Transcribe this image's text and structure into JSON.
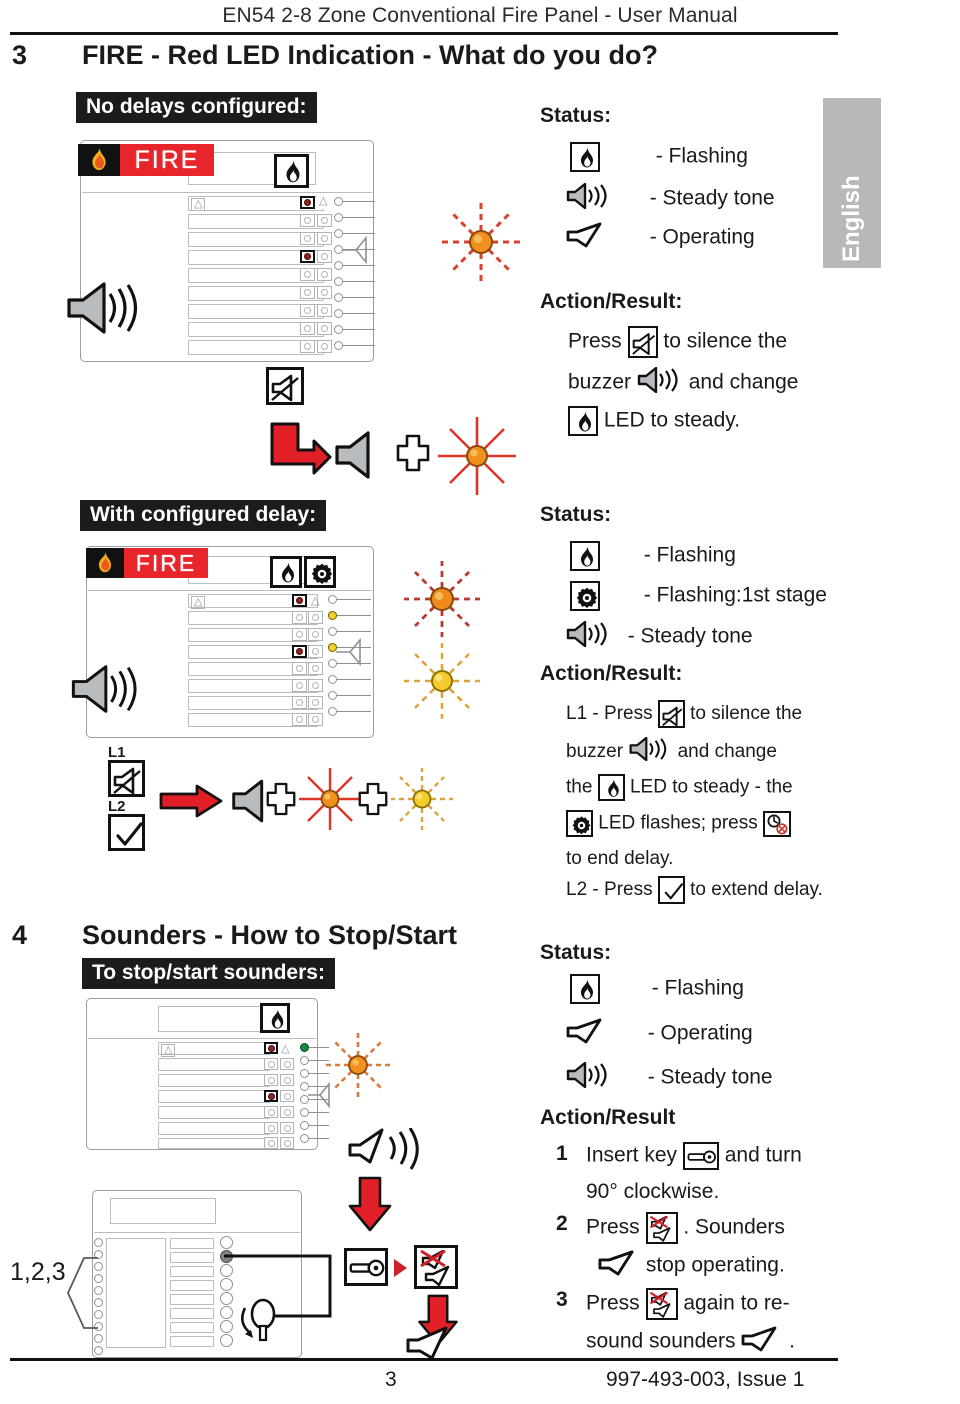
{
  "document": {
    "header_title": "EN54 2-8 Zone Conventional Fire Panel - User Manual",
    "language_tab": "English",
    "footer_page": "3",
    "footer_code": "997-493-003, Issue 1"
  },
  "colors": {
    "fire_red": "#e8252a",
    "arrow_red": "#e02026",
    "led_red": "#9e1b1b",
    "amber": "#f5a623",
    "yellow": "#f2d22a",
    "chip_black": "#1c1c1c",
    "tab_gray": "#b6b8ba",
    "panel_line": "#9b9fa3"
  },
  "section3": {
    "number": "3",
    "title": "FIRE - Red LED Indication - What do you do?",
    "case_a": {
      "chip_label": "No delays configured:",
      "panel_banner": "FIRE",
      "status_heading": "Status:",
      "status_rows": [
        {
          "icon": "fire-led-icon",
          "text": "- Flashing"
        },
        {
          "icon": "buzzer-icon",
          "text": "- Steady tone"
        },
        {
          "icon": "sounder-icon",
          "text": "- Operating"
        }
      ],
      "action_heading": "Action/Result:",
      "action_lines": [
        [
          {
            "t": "Press "
          },
          {
            "icon": "buzzer-silence-icon"
          },
          {
            "t": " to silence the"
          }
        ],
        [
          {
            "t": "buzzer "
          },
          {
            "icon": "buzzer-icon"
          },
          {
            "t": " and change"
          }
        ],
        [
          {
            "icon": "fire-led-icon"
          },
          {
            "t": " LED to steady."
          }
        ]
      ]
    },
    "case_b": {
      "chip_label": "With configured delay:",
      "panel_banner": "FIRE",
      "key_labels": {
        "l1": "L1",
        "l2": "L2"
      },
      "status_heading": "Status:",
      "status_rows": [
        {
          "icon": "fire-led-icon",
          "text": "- Flashing"
        },
        {
          "icon": "delay-gear-icon",
          "text": "- Flashing:1st stage"
        },
        {
          "icon": "buzzer-icon",
          "text": "- Steady tone"
        }
      ],
      "action_heading": "Action/Result:",
      "action_lines": [
        [
          {
            "t": "L1 - Press "
          },
          {
            "icon": "buzzer-silence-icon"
          },
          {
            "t": " to silence the"
          }
        ],
        [
          {
            "t": "buzzer "
          },
          {
            "icon": "buzzer-icon"
          },
          {
            "t": " and change"
          }
        ],
        [
          {
            "t": "the "
          },
          {
            "icon": "fire-led-icon"
          },
          {
            "t": " LED to steady - the"
          }
        ],
        [
          {
            "icon": "delay-gear-icon"
          },
          {
            "t": " LED flashes; press "
          },
          {
            "icon": "end-delay-icon"
          }
        ],
        [
          {
            "t": "to end delay."
          }
        ],
        [
          {
            "t": "L2 - Press "
          },
          {
            "icon": "tick-icon"
          },
          {
            "t": " to extend delay."
          }
        ]
      ]
    }
  },
  "section4": {
    "number": "4",
    "title": "Sounders - How to Stop/Start",
    "chip_label": "To stop/start sounders:",
    "step_marker": "1,2,3",
    "status_heading": "Status:",
    "status_rows": [
      {
        "icon": "fire-led-icon",
        "text": "- Flashing"
      },
      {
        "icon": "sounder-icon",
        "text": "- Operating"
      },
      {
        "icon": "buzzer-icon",
        "text": "- Steady tone"
      }
    ],
    "action_heading": "Action/Result",
    "steps": [
      {
        "number": "1",
        "line1": [
          {
            "t": "Insert key "
          },
          {
            "icon": "key-icon"
          },
          {
            "t": " and turn"
          }
        ],
        "line2": [
          {
            "t": "90° clockwise."
          }
        ]
      },
      {
        "number": "2",
        "line1": [
          {
            "t": "Press "
          },
          {
            "icon": "sounder-silence-icon"
          },
          {
            "t": ". Sounders"
          }
        ],
        "line2": [
          {
            "icon": "sounder-icon"
          },
          {
            "t": " stop operating."
          }
        ]
      },
      {
        "number": "3",
        "line1": [
          {
            "t": "Press "
          },
          {
            "icon": "sounder-silence-icon"
          },
          {
            "t": " again to re-"
          }
        ],
        "line2": [
          {
            "t": "sound sounders "
          },
          {
            "icon": "sounder-icon"
          },
          {
            "t": "."
          }
        ]
      }
    ]
  }
}
